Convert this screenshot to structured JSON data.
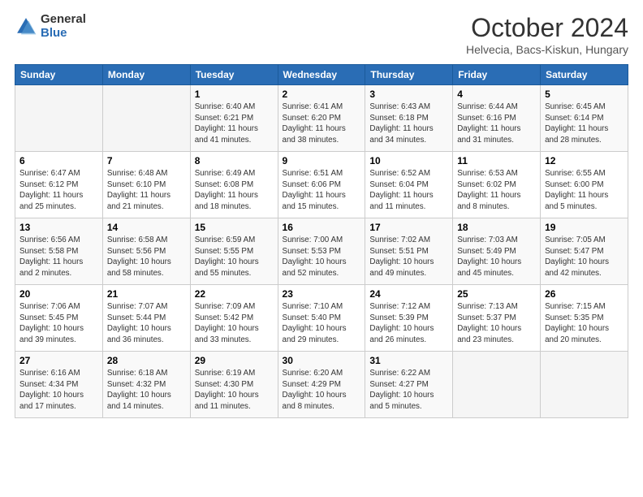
{
  "header": {
    "logo_general": "General",
    "logo_blue": "Blue",
    "title": "October 2024",
    "subtitle": "Helvecia, Bacs-Kiskun, Hungary"
  },
  "weekdays": [
    "Sunday",
    "Monday",
    "Tuesday",
    "Wednesday",
    "Thursday",
    "Friday",
    "Saturday"
  ],
  "weeks": [
    [
      {
        "day": "",
        "info": ""
      },
      {
        "day": "",
        "info": ""
      },
      {
        "day": "1",
        "info": "Sunrise: 6:40 AM\nSunset: 6:21 PM\nDaylight: 11 hours\nand 41 minutes."
      },
      {
        "day": "2",
        "info": "Sunrise: 6:41 AM\nSunset: 6:20 PM\nDaylight: 11 hours\nand 38 minutes."
      },
      {
        "day": "3",
        "info": "Sunrise: 6:43 AM\nSunset: 6:18 PM\nDaylight: 11 hours\nand 34 minutes."
      },
      {
        "day": "4",
        "info": "Sunrise: 6:44 AM\nSunset: 6:16 PM\nDaylight: 11 hours\nand 31 minutes."
      },
      {
        "day": "5",
        "info": "Sunrise: 6:45 AM\nSunset: 6:14 PM\nDaylight: 11 hours\nand 28 minutes."
      }
    ],
    [
      {
        "day": "6",
        "info": "Sunrise: 6:47 AM\nSunset: 6:12 PM\nDaylight: 11 hours\nand 25 minutes."
      },
      {
        "day": "7",
        "info": "Sunrise: 6:48 AM\nSunset: 6:10 PM\nDaylight: 11 hours\nand 21 minutes."
      },
      {
        "day": "8",
        "info": "Sunrise: 6:49 AM\nSunset: 6:08 PM\nDaylight: 11 hours\nand 18 minutes."
      },
      {
        "day": "9",
        "info": "Sunrise: 6:51 AM\nSunset: 6:06 PM\nDaylight: 11 hours\nand 15 minutes."
      },
      {
        "day": "10",
        "info": "Sunrise: 6:52 AM\nSunset: 6:04 PM\nDaylight: 11 hours\nand 11 minutes."
      },
      {
        "day": "11",
        "info": "Sunrise: 6:53 AM\nSunset: 6:02 PM\nDaylight: 11 hours\nand 8 minutes."
      },
      {
        "day": "12",
        "info": "Sunrise: 6:55 AM\nSunset: 6:00 PM\nDaylight: 11 hours\nand 5 minutes."
      }
    ],
    [
      {
        "day": "13",
        "info": "Sunrise: 6:56 AM\nSunset: 5:58 PM\nDaylight: 11 hours\nand 2 minutes."
      },
      {
        "day": "14",
        "info": "Sunrise: 6:58 AM\nSunset: 5:56 PM\nDaylight: 10 hours\nand 58 minutes."
      },
      {
        "day": "15",
        "info": "Sunrise: 6:59 AM\nSunset: 5:55 PM\nDaylight: 10 hours\nand 55 minutes."
      },
      {
        "day": "16",
        "info": "Sunrise: 7:00 AM\nSunset: 5:53 PM\nDaylight: 10 hours\nand 52 minutes."
      },
      {
        "day": "17",
        "info": "Sunrise: 7:02 AM\nSunset: 5:51 PM\nDaylight: 10 hours\nand 49 minutes."
      },
      {
        "day": "18",
        "info": "Sunrise: 7:03 AM\nSunset: 5:49 PM\nDaylight: 10 hours\nand 45 minutes."
      },
      {
        "day": "19",
        "info": "Sunrise: 7:05 AM\nSunset: 5:47 PM\nDaylight: 10 hours\nand 42 minutes."
      }
    ],
    [
      {
        "day": "20",
        "info": "Sunrise: 7:06 AM\nSunset: 5:45 PM\nDaylight: 10 hours\nand 39 minutes."
      },
      {
        "day": "21",
        "info": "Sunrise: 7:07 AM\nSunset: 5:44 PM\nDaylight: 10 hours\nand 36 minutes."
      },
      {
        "day": "22",
        "info": "Sunrise: 7:09 AM\nSunset: 5:42 PM\nDaylight: 10 hours\nand 33 minutes."
      },
      {
        "day": "23",
        "info": "Sunrise: 7:10 AM\nSunset: 5:40 PM\nDaylight: 10 hours\nand 29 minutes."
      },
      {
        "day": "24",
        "info": "Sunrise: 7:12 AM\nSunset: 5:39 PM\nDaylight: 10 hours\nand 26 minutes."
      },
      {
        "day": "25",
        "info": "Sunrise: 7:13 AM\nSunset: 5:37 PM\nDaylight: 10 hours\nand 23 minutes."
      },
      {
        "day": "26",
        "info": "Sunrise: 7:15 AM\nSunset: 5:35 PM\nDaylight: 10 hours\nand 20 minutes."
      }
    ],
    [
      {
        "day": "27",
        "info": "Sunrise: 6:16 AM\nSunset: 4:34 PM\nDaylight: 10 hours\nand 17 minutes."
      },
      {
        "day": "28",
        "info": "Sunrise: 6:18 AM\nSunset: 4:32 PM\nDaylight: 10 hours\nand 14 minutes."
      },
      {
        "day": "29",
        "info": "Sunrise: 6:19 AM\nSunset: 4:30 PM\nDaylight: 10 hours\nand 11 minutes."
      },
      {
        "day": "30",
        "info": "Sunrise: 6:20 AM\nSunset: 4:29 PM\nDaylight: 10 hours\nand 8 minutes."
      },
      {
        "day": "31",
        "info": "Sunrise: 6:22 AM\nSunset: 4:27 PM\nDaylight: 10 hours\nand 5 minutes."
      },
      {
        "day": "",
        "info": ""
      },
      {
        "day": "",
        "info": ""
      }
    ]
  ]
}
